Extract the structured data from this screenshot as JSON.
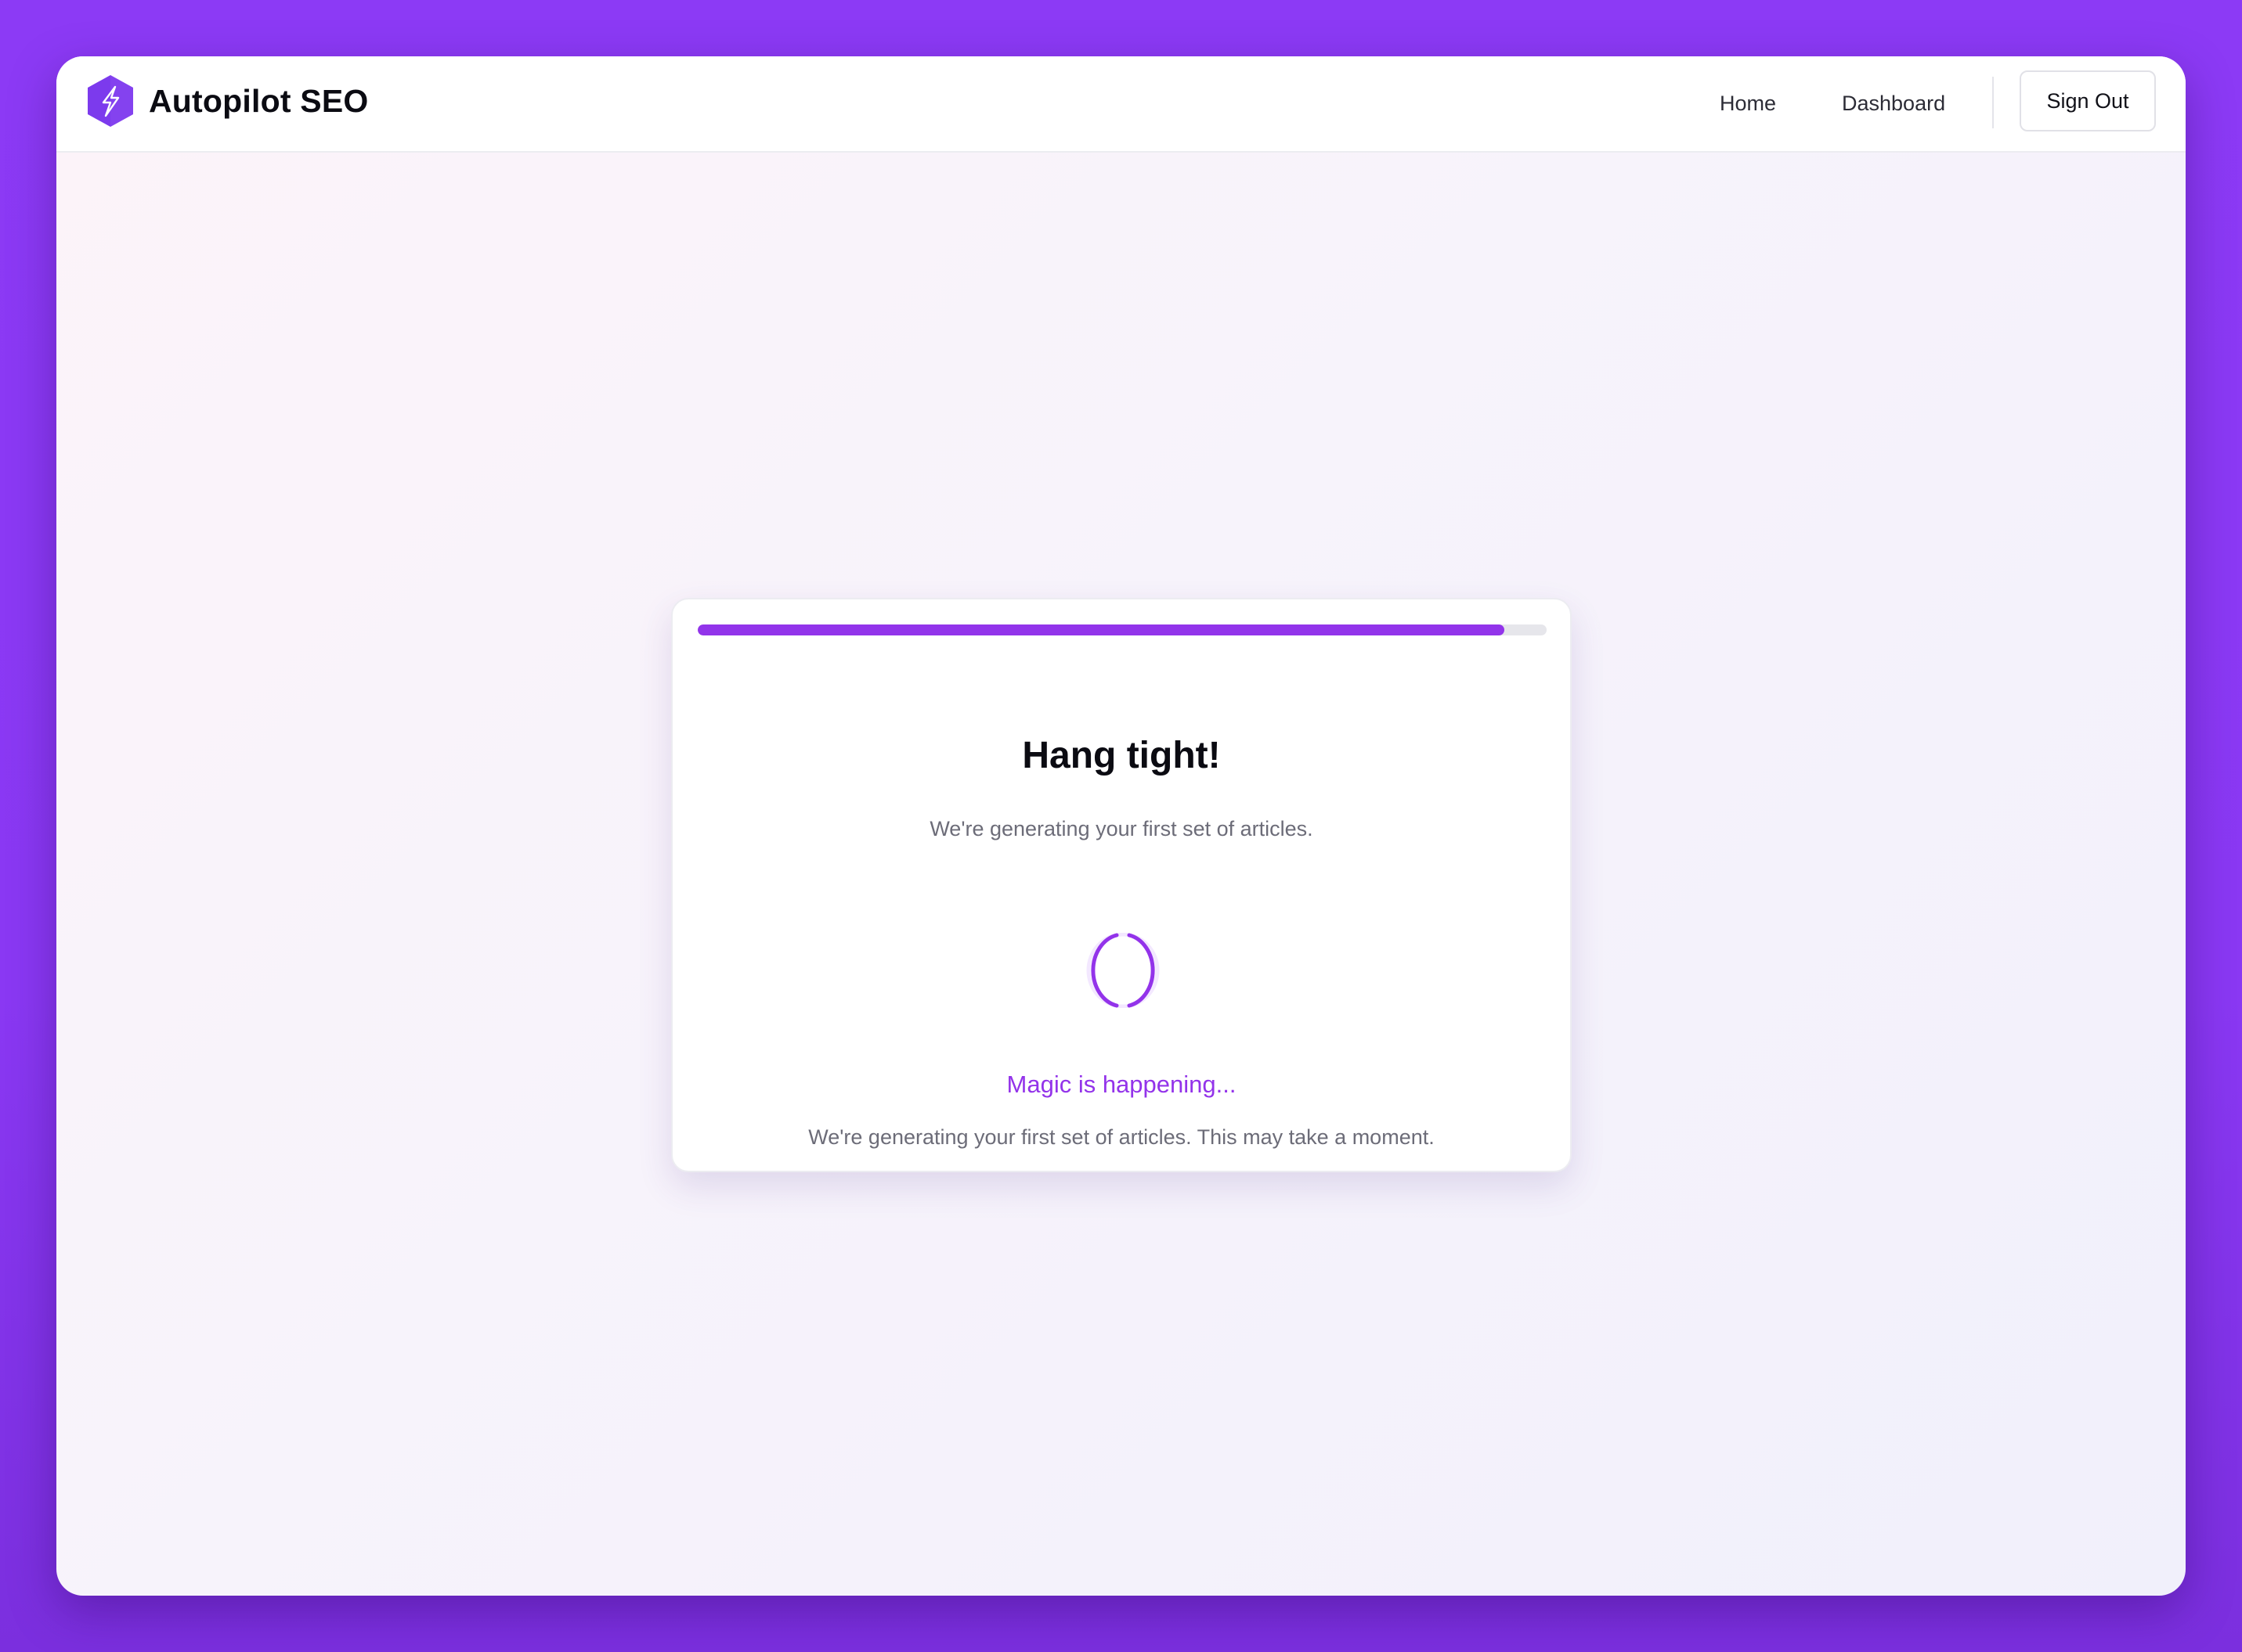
{
  "app": {
    "brand_name": "Autopilot SEO",
    "logo_icon": "lightning-hexagon-icon",
    "accent_color": "#9333ea"
  },
  "nav": {
    "links": [
      {
        "label": "Home"
      },
      {
        "label": "Dashboard"
      }
    ],
    "sign_out_label": "Sign Out"
  },
  "card": {
    "progress": 0.95,
    "title": "Hang tight!",
    "subtitle": "We're generating your first set of articles.",
    "spinner_icon": "loading-spinner-icon",
    "status_text": "Magic is happening...",
    "status_detail": "We're generating your first set of articles. This may take a moment."
  }
}
